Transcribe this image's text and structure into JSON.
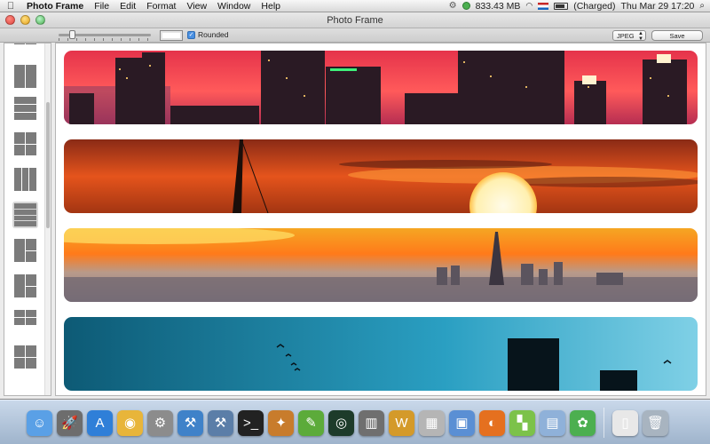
{
  "menubar": {
    "apple_icon": "apple-icon",
    "app_name": "Photo Frame",
    "menus": [
      "File",
      "Edit",
      "Format",
      "View",
      "Window",
      "Help"
    ],
    "memory": "833.43 MB",
    "battery": "(Charged)",
    "datetime": "Thu Mar 29  17:20"
  },
  "window": {
    "title": "Photo Frame"
  },
  "toolbar": {
    "rounded_label": "Rounded",
    "rounded_checked": true,
    "format_value": "JPEG",
    "save_label": "Save"
  },
  "sidebar": {
    "layouts": [
      {
        "name": "layout-1",
        "cols": "1fr 1fr",
        "rows": "1fr 1fr",
        "cells": 2
      },
      {
        "name": "layout-2",
        "cols": "1fr 1fr",
        "rows": "1fr",
        "cells": 2
      },
      {
        "name": "layout-3",
        "cols": "1fr",
        "rows": "1fr 1fr 1fr",
        "cells": 3
      },
      {
        "name": "layout-4",
        "cols": "1fr 1fr",
        "rows": "1fr 1fr",
        "cells": 4
      },
      {
        "name": "layout-5",
        "cols": "1fr 1fr 1fr",
        "rows": "1fr",
        "cells": 3
      },
      {
        "name": "layout-6",
        "cols": "1fr",
        "rows": "1fr 1fr 1fr 1fr",
        "cells": 4,
        "selected": true
      },
      {
        "name": "layout-7",
        "cols": "1fr 1fr",
        "rows": "1fr 1fr",
        "cells": 3
      },
      {
        "name": "layout-8",
        "cols": "1fr 1fr",
        "rows": "1fr 1fr",
        "cells": 3
      },
      {
        "name": "layout-9",
        "cols": "1fr 1fr",
        "rows": "1fr 1fr 1fr",
        "cells": 4
      },
      {
        "name": "layout-10",
        "cols": "1fr 1fr",
        "rows": "1fr 1fr",
        "cells": 4
      }
    ]
  },
  "photos": [
    {
      "name": "photo-city-skyline-sunset"
    },
    {
      "name": "photo-sunset-sailboat"
    },
    {
      "name": "photo-paris-skyline"
    },
    {
      "name": "photo-birds-blue-sky"
    }
  ],
  "dock": {
    "icons": [
      {
        "name": "finder-icon",
        "bg": "#5aa0e6",
        "glyph": "☺"
      },
      {
        "name": "launchpad-icon",
        "bg": "#6d6d6d",
        "glyph": "🚀"
      },
      {
        "name": "app-store-icon",
        "bg": "#2f7fd8",
        "glyph": "A"
      },
      {
        "name": "chrome-icon",
        "bg": "#e8b53a",
        "glyph": "◉"
      },
      {
        "name": "system-preferences-icon",
        "bg": "#8c8c8c",
        "glyph": "⚙"
      },
      {
        "name": "xcode-icon",
        "bg": "#3f82c9",
        "glyph": "⚒"
      },
      {
        "name": "instruments-icon",
        "bg": "#5b7ea8",
        "glyph": "⚒"
      },
      {
        "name": "terminal-icon",
        "bg": "#222222",
        "glyph": ">_"
      },
      {
        "name": "raygun-icon",
        "bg": "#c87c2c",
        "glyph": "✦"
      },
      {
        "name": "evernote-icon",
        "bg": "#5cab3a",
        "glyph": "✎"
      },
      {
        "name": "grapher-icon",
        "bg": "#1d3b2a",
        "glyph": "◎"
      },
      {
        "name": "activity-monitor-icon",
        "bg": "#6f6f6f",
        "glyph": "▥"
      },
      {
        "name": "textwrangler-icon",
        "bg": "#d49a2a",
        "glyph": "W"
      },
      {
        "name": "calculator-icon",
        "bg": "#b5b5b5",
        "glyph": "▦"
      },
      {
        "name": "preview-icon",
        "bg": "#5a8fd4",
        "glyph": "▣"
      },
      {
        "name": "firefox-icon",
        "bg": "#e5701f",
        "glyph": "◐"
      },
      {
        "name": "palette-icon",
        "bg": "#7cc24a",
        "glyph": "▚"
      },
      {
        "name": "photo-frame-icon",
        "bg": "#8fb1d9",
        "glyph": "▤"
      },
      {
        "name": "green-figure-icon",
        "bg": "#4caf50",
        "glyph": "✿"
      },
      {
        "name": "document-icon",
        "bg": "#e8e8e8",
        "glyph": "▯"
      },
      {
        "name": "trash-icon",
        "bg": "#a8b4c0",
        "glyph": "🗑"
      }
    ]
  }
}
